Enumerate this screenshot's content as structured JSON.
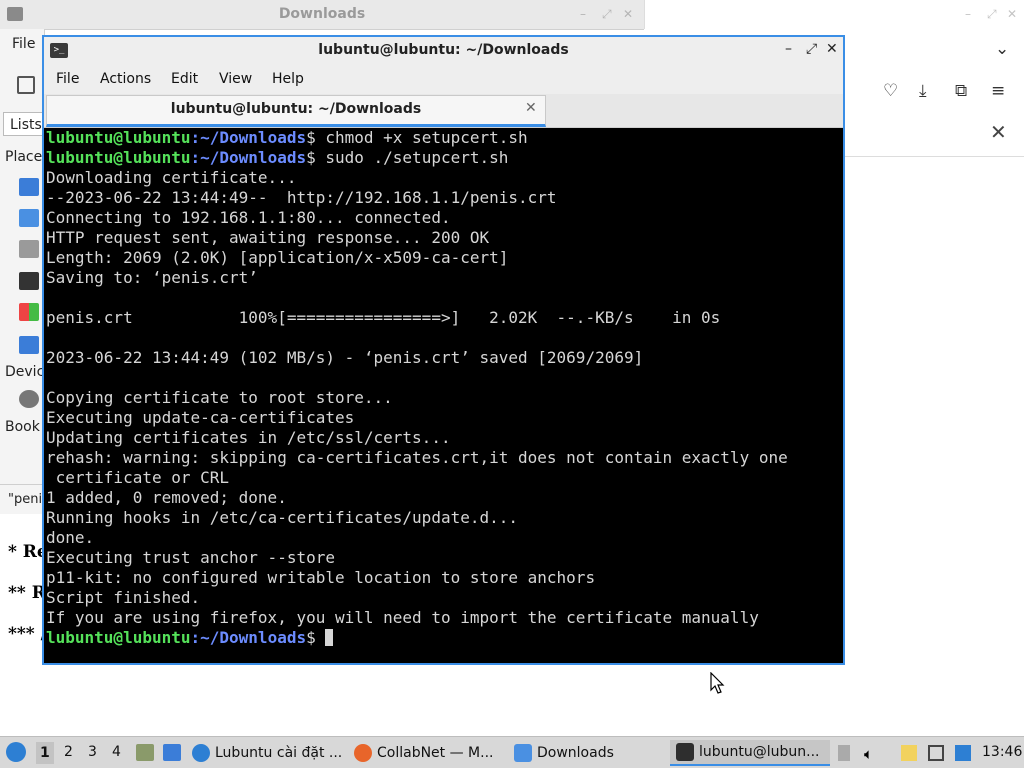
{
  "file_manager": {
    "title": "Downloads",
    "menu_file": "File",
    "tab_lists": "Lists",
    "places_label": "Place",
    "devices_label": "Devic",
    "bookmarks_label": "Book",
    "status_text": "\"peni"
  },
  "page_content": {
    "lines": [
      "* Re",
      "** R",
      "*** /"
    ]
  },
  "terminal": {
    "window_title": "lubuntu@lubuntu: ~/Downloads",
    "menus": [
      "File",
      "Actions",
      "Edit",
      "View",
      "Help"
    ],
    "tab_label": "lubuntu@lubuntu: ~/Downloads",
    "prompt_user": "lubuntu@lubuntu",
    "prompt_path": ":~/Downloads",
    "prompt_end": "$ ",
    "commands": [
      "chmod +x setupcert.sh",
      "sudo ./setupcert.sh"
    ],
    "output": [
      "Downloading certificate...",
      "--2023-06-22 13:44:49--  http://192.168.1.1/penis.crt",
      "Connecting to 192.168.1.1:80... connected.",
      "HTTP request sent, awaiting response... 200 OK",
      "Length: 2069 (2.0K) [application/x-x509-ca-cert]",
      "Saving to: ‘penis.crt’",
      "",
      "penis.crt           100%[================>]   2.02K  --.-KB/s    in 0s",
      "",
      "2023-06-22 13:44:49 (102 MB/s) - ‘penis.crt’ saved [2069/2069]",
      "",
      "Copying certificate to root store...",
      "Executing update-ca-certificates",
      "Updating certificates in /etc/ssl/certs...",
      "rehash: warning: skipping ca-certificates.crt,it does not contain exactly one",
      " certificate or CRL",
      "1 added, 0 removed; done.",
      "Running hooks in /etc/ca-certificates/update.d...",
      "done.",
      "Executing trust anchor --store",
      "p11-kit: no configured writable location to store anchors",
      "Script finished.",
      "If you are using firefox, you will need to import the certificate manually"
    ]
  },
  "taskbar": {
    "workspaces": [
      "1",
      "2",
      "3",
      "4"
    ],
    "tasks": [
      {
        "label": "Lubuntu cài đặt ...",
        "icon": "lubuntu-icon"
      },
      {
        "label": "CollabNet — M...",
        "icon": "firefox-icon"
      },
      {
        "label": "Downloads",
        "icon": "folder-icon"
      },
      {
        "label": "lubuntu@lubun...",
        "icon": "terminal-icon"
      }
    ],
    "clock": "13:46"
  },
  "colors": {
    "accent": "#3a8ee6",
    "prompt_user": "#55e25a",
    "prompt_path": "#6c8cff",
    "terminal_bg": "#000000",
    "terminal_fg": "#d6d6d6"
  }
}
